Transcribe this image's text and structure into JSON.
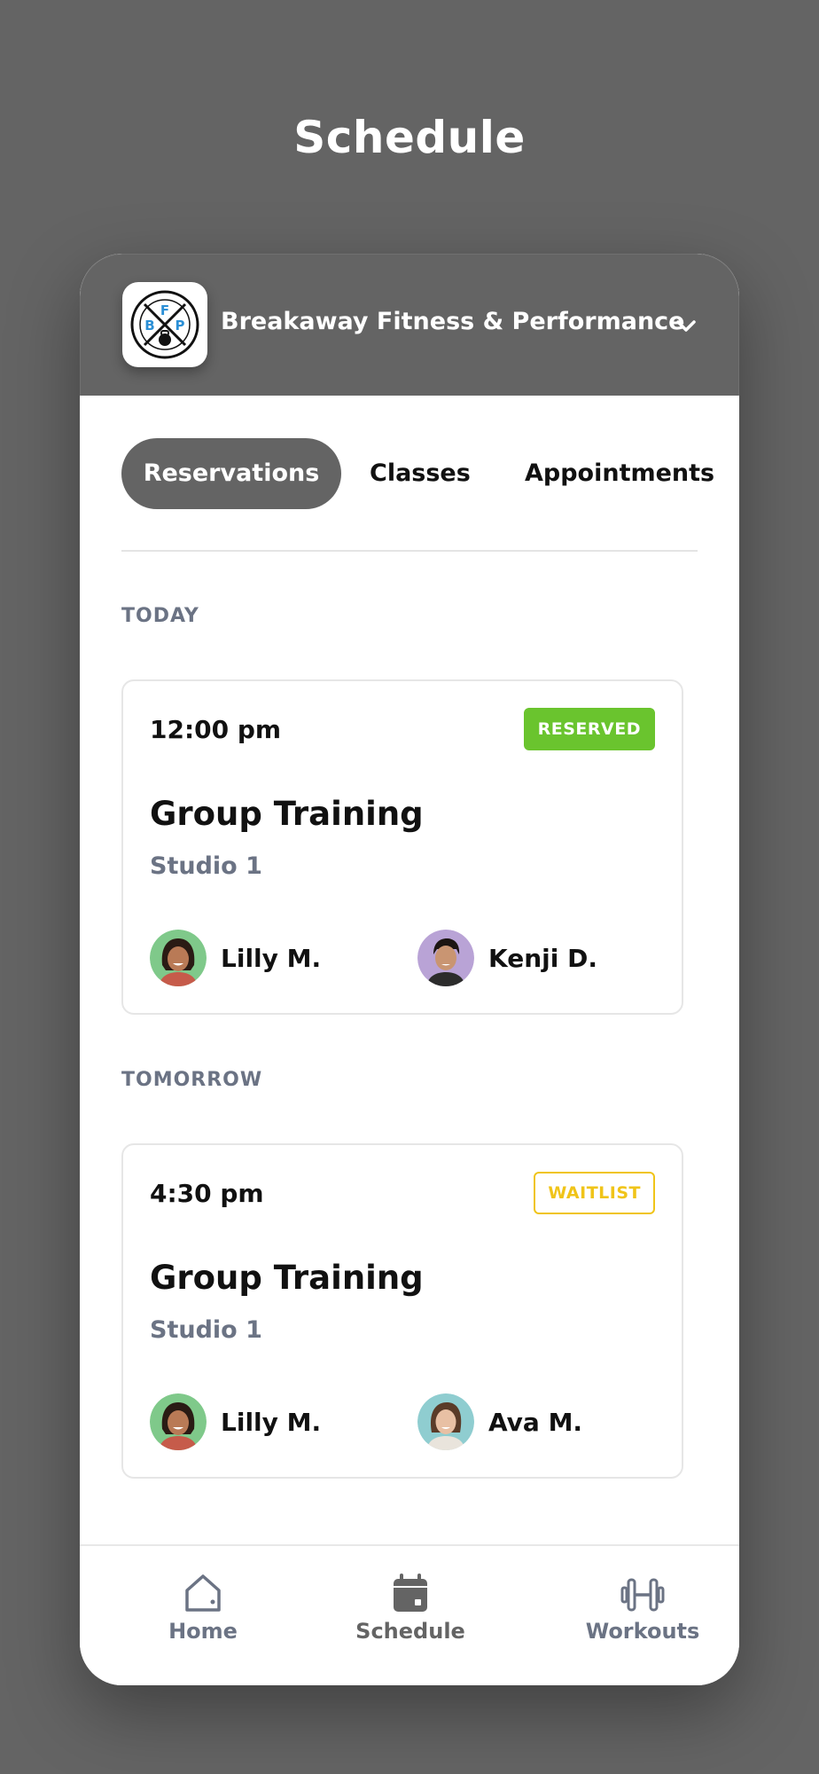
{
  "page": {
    "title": "Schedule"
  },
  "gym": {
    "name": "Breakaway Fitness & Performance",
    "logo_letters": [
      "B",
      "F",
      "P"
    ],
    "logo_ring_text": "BREAKAWAY FITNESS & PERFORMANCE · NORTH CAROLINA",
    "logo_accent_color": "#2b8fd6"
  },
  "tabs": [
    {
      "label": "Reservations",
      "active": true
    },
    {
      "label": "Classes",
      "active": false
    },
    {
      "label": "Appointments",
      "active": false
    }
  ],
  "sections": [
    {
      "label": "TODAY",
      "card": {
        "time": "12:00 pm",
        "status": "RESERVED",
        "title": "Group Training",
        "location": "Studio 1",
        "attendees": [
          {
            "name": "Lilly M.",
            "avatar_bg": "#7fc98a"
          },
          {
            "name": "Kenji D.",
            "avatar_bg": "#b9a3d6"
          }
        ]
      }
    },
    {
      "label": "TOMORROW",
      "card": {
        "time": "4:30 pm",
        "status": "WAITLIST",
        "title": "Group Training",
        "location": "Studio 1",
        "attendees": [
          {
            "name": "Lilly M.",
            "avatar_bg": "#7fc98a"
          },
          {
            "name": "Ava M.",
            "avatar_bg": "#8fcdd0"
          }
        ]
      }
    }
  ],
  "status_colors": {
    "reserved": "#6ac42e",
    "waitlist": "#f0c419"
  },
  "nav": [
    {
      "label": "Home",
      "icon": "home-icon"
    },
    {
      "label": "Schedule",
      "icon": "calendar-icon",
      "active": true
    },
    {
      "label": "Workouts",
      "icon": "dumbbell-icon"
    }
  ]
}
